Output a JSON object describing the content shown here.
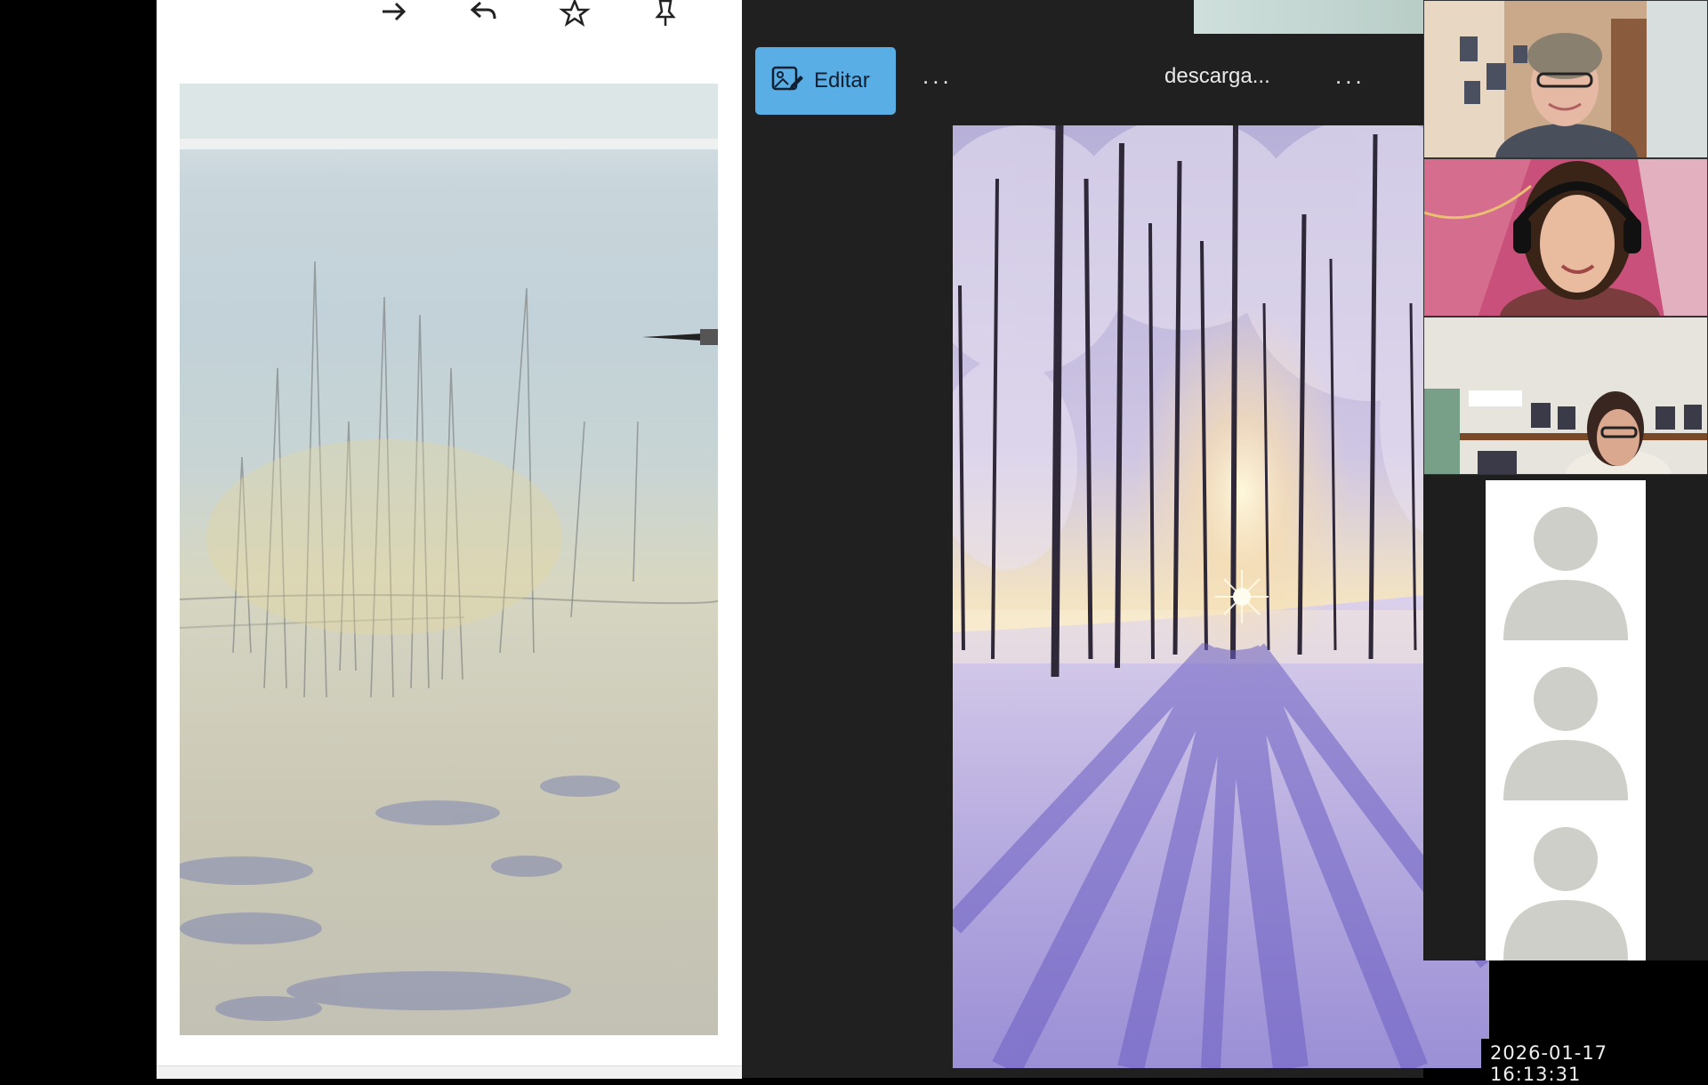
{
  "toolbar": {
    "icons": [
      "forward-icon",
      "reply-icon",
      "star-icon",
      "pin-icon",
      "emoji-icon",
      "forward-all-icon",
      "download-icon",
      "open-external-icon",
      "close-icon"
    ]
  },
  "viewer": {
    "edit_label": "Editar",
    "more_label": "...",
    "filename": "descarga...",
    "filename_more_label": "..."
  },
  "participants": {
    "video_tiles": [
      "participant-video-1",
      "participant-video-2",
      "participant-video-3"
    ],
    "avatar_tiles": [
      "participant-avatar-1",
      "participant-avatar-2",
      "participant-avatar-3"
    ]
  },
  "overlay": {
    "timestamp": "2026-01-17  16:13:31"
  },
  "colors": {
    "edit_button": "#5aaee6",
    "viewer_bg": "#202020"
  }
}
